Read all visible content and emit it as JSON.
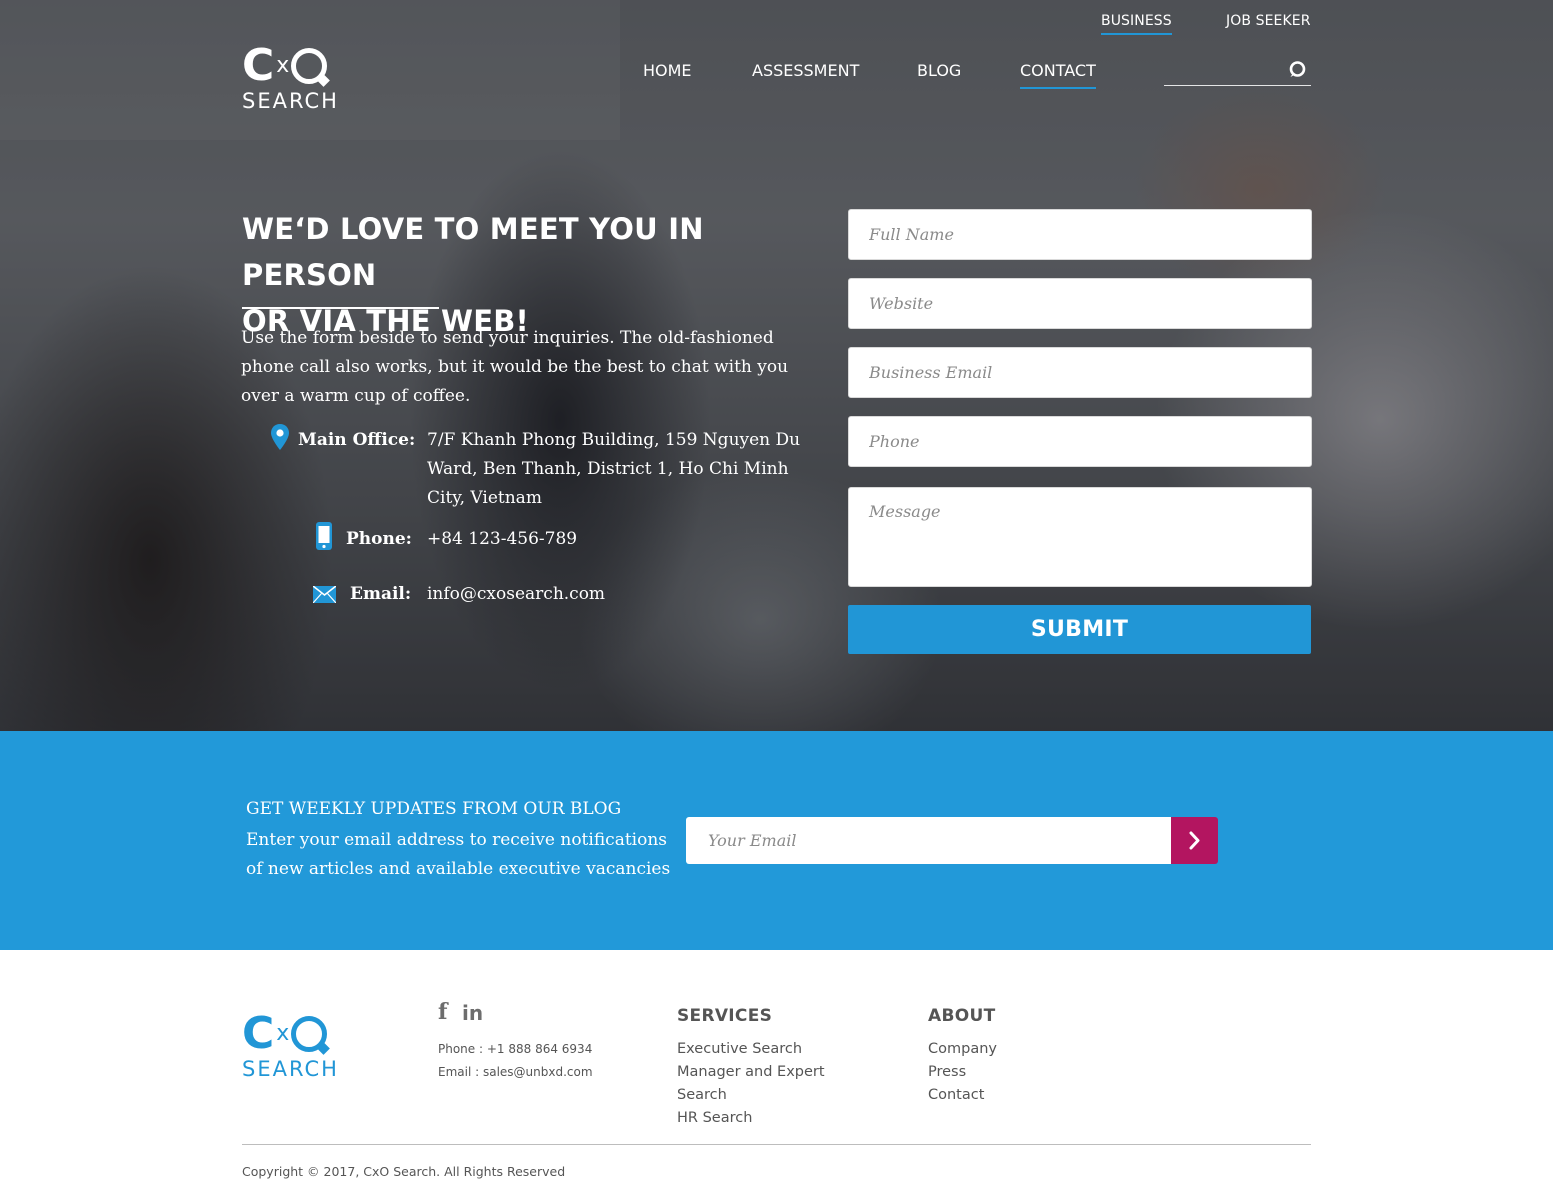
{
  "brand": {
    "logo_mark_c": "C",
    "logo_mark_x": "x",
    "logo_word": "SEARCH"
  },
  "top_links": [
    {
      "label": "BUSINESS",
      "active": true
    },
    {
      "label": "JOB SEEKER",
      "active": false
    }
  ],
  "nav": [
    {
      "label": "HOME",
      "active": false
    },
    {
      "label": "ASSESSMENT",
      "active": false
    },
    {
      "label": "BLOG",
      "active": false
    },
    {
      "label": "CONTACT",
      "active": true
    }
  ],
  "search": {
    "placeholder": ""
  },
  "hero": {
    "headline_line1": "WE‘D LOVE TO MEET YOU IN PERSON",
    "headline_line2": "OR VIA THE WEB!",
    "intro": "Use the form beside to send your inquiries. The old-fashioned phone call also works, but it would be the best to chat with you over a warm cup of coffee."
  },
  "contact": {
    "office_label": "Main Office:",
    "office_value": "7/F Khanh Phong Building, 159 Nguyen Du Ward, Ben Thanh, District 1, Ho Chi Minh City,  Vietnam",
    "phone_label": "Phone:",
    "phone_value": "+84 123-456-789",
    "email_label": "Email:",
    "email_value": "info@cxosearch.com"
  },
  "form": {
    "full_name_placeholder": "Full Name",
    "website_placeholder": "Website",
    "business_email_placeholder": "Business Email",
    "phone_placeholder": "Phone",
    "message_placeholder": "Message",
    "submit_label": "SUBMIT"
  },
  "newsletter": {
    "title": "GET WEEKLY UPDATES FROM OUR BLOG",
    "text": "Enter your email address to receive notifications of new articles and available executive vacancies",
    "email_placeholder": "Your Email"
  },
  "footer": {
    "social": [
      "f",
      "in"
    ],
    "phone": "Phone : +1 888 864 6934",
    "email": "Email : sales@unbxd.com",
    "services_title": "SERVICES",
    "services": [
      "Executive Search",
      "Manager and Expert",
      "Search",
      "HR Search"
    ],
    "about_title": "ABOUT",
    "about": [
      "Company",
      "Press",
      "Contact"
    ],
    "copyright": "Copyright © 2017, CxO Search. All Rights Reserved"
  },
  "colors": {
    "accent": "#2196d6",
    "newsletter_bg": "#2299d9",
    "newsletter_button": "#b31560",
    "footer_text": "#555555"
  },
  "icons": [
    "search-icon",
    "map-pin-icon",
    "mobile-phone-icon",
    "envelope-icon",
    "chevron-right-icon",
    "facebook-icon",
    "linkedin-icon"
  ]
}
